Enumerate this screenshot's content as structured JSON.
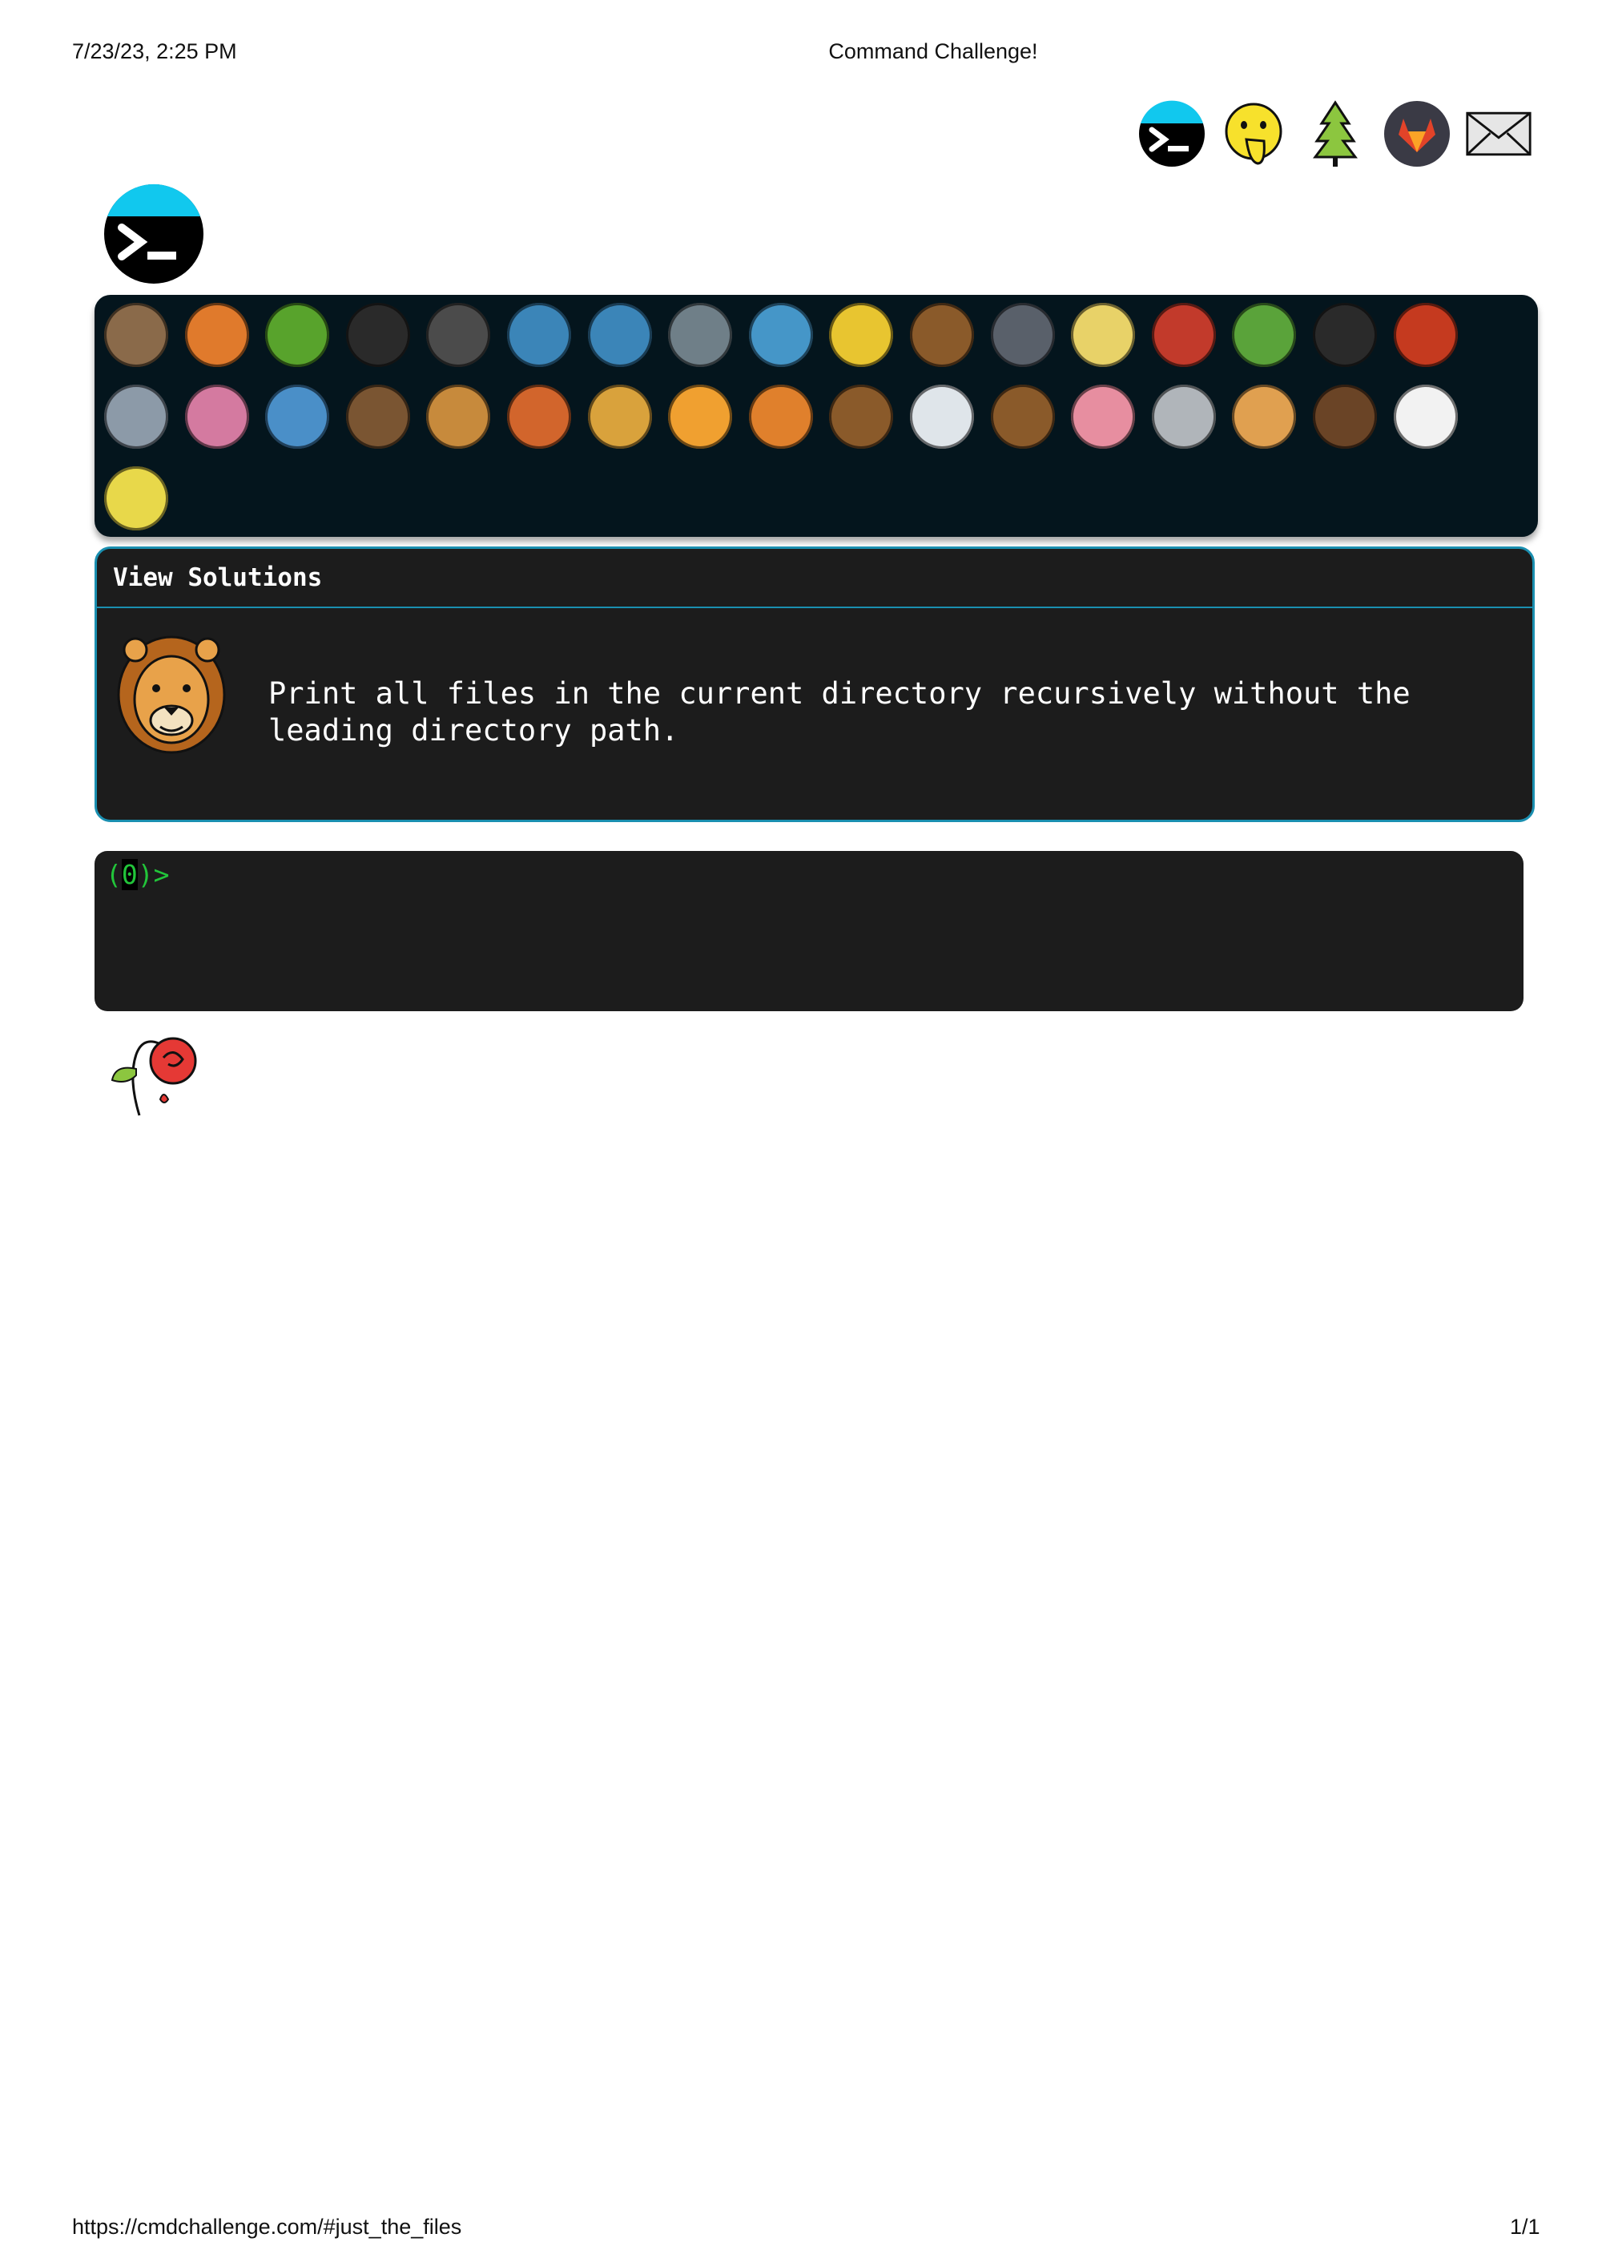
{
  "print_header": {
    "date": "7/23/23, 2:25 PM",
    "title": "Command Challenge!"
  },
  "print_footer": {
    "url": "https://cmdchallenge.com/#just_the_files",
    "page": "1/1"
  },
  "top_icons": [
    "terminal-icon",
    "face-hand-over-mouth-icon",
    "tree-icon",
    "gitlab-icon",
    "envelope-icon"
  ],
  "animal_panel": {
    "animals": [
      {
        "name": "snail",
        "label": "",
        "color": "#8a6a4a"
      },
      {
        "name": "butterfly",
        "label": "",
        "color": "#e07a2c"
      },
      {
        "name": "caterpillar",
        "label": "",
        "color": "#58a32c"
      },
      {
        "name": "ant",
        "label": "",
        "color": "#2a2a2a"
      },
      {
        "name": "spider-web",
        "label": "",
        "color": "#4b4b4b"
      },
      {
        "name": "whale",
        "label": "",
        "color": "#3b85b8"
      },
      {
        "name": "dolphin",
        "label": "",
        "color": "#3b85b8"
      },
      {
        "name": "dolphin-gray",
        "label": "",
        "color": "#6f7f88"
      },
      {
        "name": "fish",
        "label": "",
        "color": "#4596c8"
      },
      {
        "name": "tropical-fish",
        "label": "",
        "color": "#e8c530"
      },
      {
        "name": "pufferfish",
        "label": "",
        "color": "#8a5a2a"
      },
      {
        "name": "wolf",
        "label": "",
        "color": "#59606a"
      },
      {
        "name": "bee",
        "label": "",
        "color": "#e8d268"
      },
      {
        "name": "ladybug",
        "label": "",
        "color": "#c23a2b"
      },
      {
        "name": "cricket",
        "label": "",
        "color": "#5aa33a"
      },
      {
        "name": "spider",
        "label": "",
        "color": "#2a2a2a"
      },
      {
        "name": "scorpion",
        "label": "",
        "color": "#c53a1f"
      },
      {
        "name": "fly",
        "label": "",
        "color": "#8c9aa8"
      },
      {
        "name": "worm",
        "label": "",
        "color": "#d47aa0"
      },
      {
        "name": "microbe",
        "label": "",
        "color": "#4a8fc8"
      },
      {
        "name": "monkey",
        "label": "",
        "color": "#7a5532"
      },
      {
        "name": "dog",
        "label": "",
        "color": "#c78a3c"
      },
      {
        "name": "fox",
        "label": "",
        "color": "#d2652c"
      },
      {
        "name": "cat",
        "label": "",
        "color": "#d9a23c"
      },
      {
        "name": "lion",
        "label": "",
        "color": "#f0a030"
      },
      {
        "name": "tiger",
        "label": "",
        "color": "#e0802c"
      },
      {
        "name": "horse",
        "label": "",
        "color": "#8a5a2a"
      },
      {
        "name": "unicorn",
        "label": "",
        "color": "#dfe5ea"
      },
      {
        "name": "cow",
        "label": "",
        "color": "#8a5a2a"
      },
      {
        "name": "pig",
        "label": "",
        "color": "#e78ea0"
      },
      {
        "name": "mouse",
        "label": "",
        "color": "#b0b5ba"
      },
      {
        "name": "hamster",
        "label": "",
        "color": "#e0a050"
      },
      {
        "name": "bear",
        "label": "",
        "color": "#6a4426"
      },
      {
        "name": "panda",
        "label": "",
        "color": "#f2f2f2"
      },
      {
        "name": "hatching-chick",
        "label": "",
        "color": "#e8d84a"
      }
    ]
  },
  "solutions": {
    "header": "View Solutions",
    "challenge_text": "Print all files in the current directory recursively without the\nleading directory path."
  },
  "terminal": {
    "prompt_open": "(",
    "prompt_count": "0",
    "prompt_close": ")>"
  },
  "colors": {
    "panel_bg": "#04151d",
    "accent_border": "#1a8fb0",
    "terminal_bg": "#1c1c1c",
    "prompt_green": "#22c53a"
  }
}
